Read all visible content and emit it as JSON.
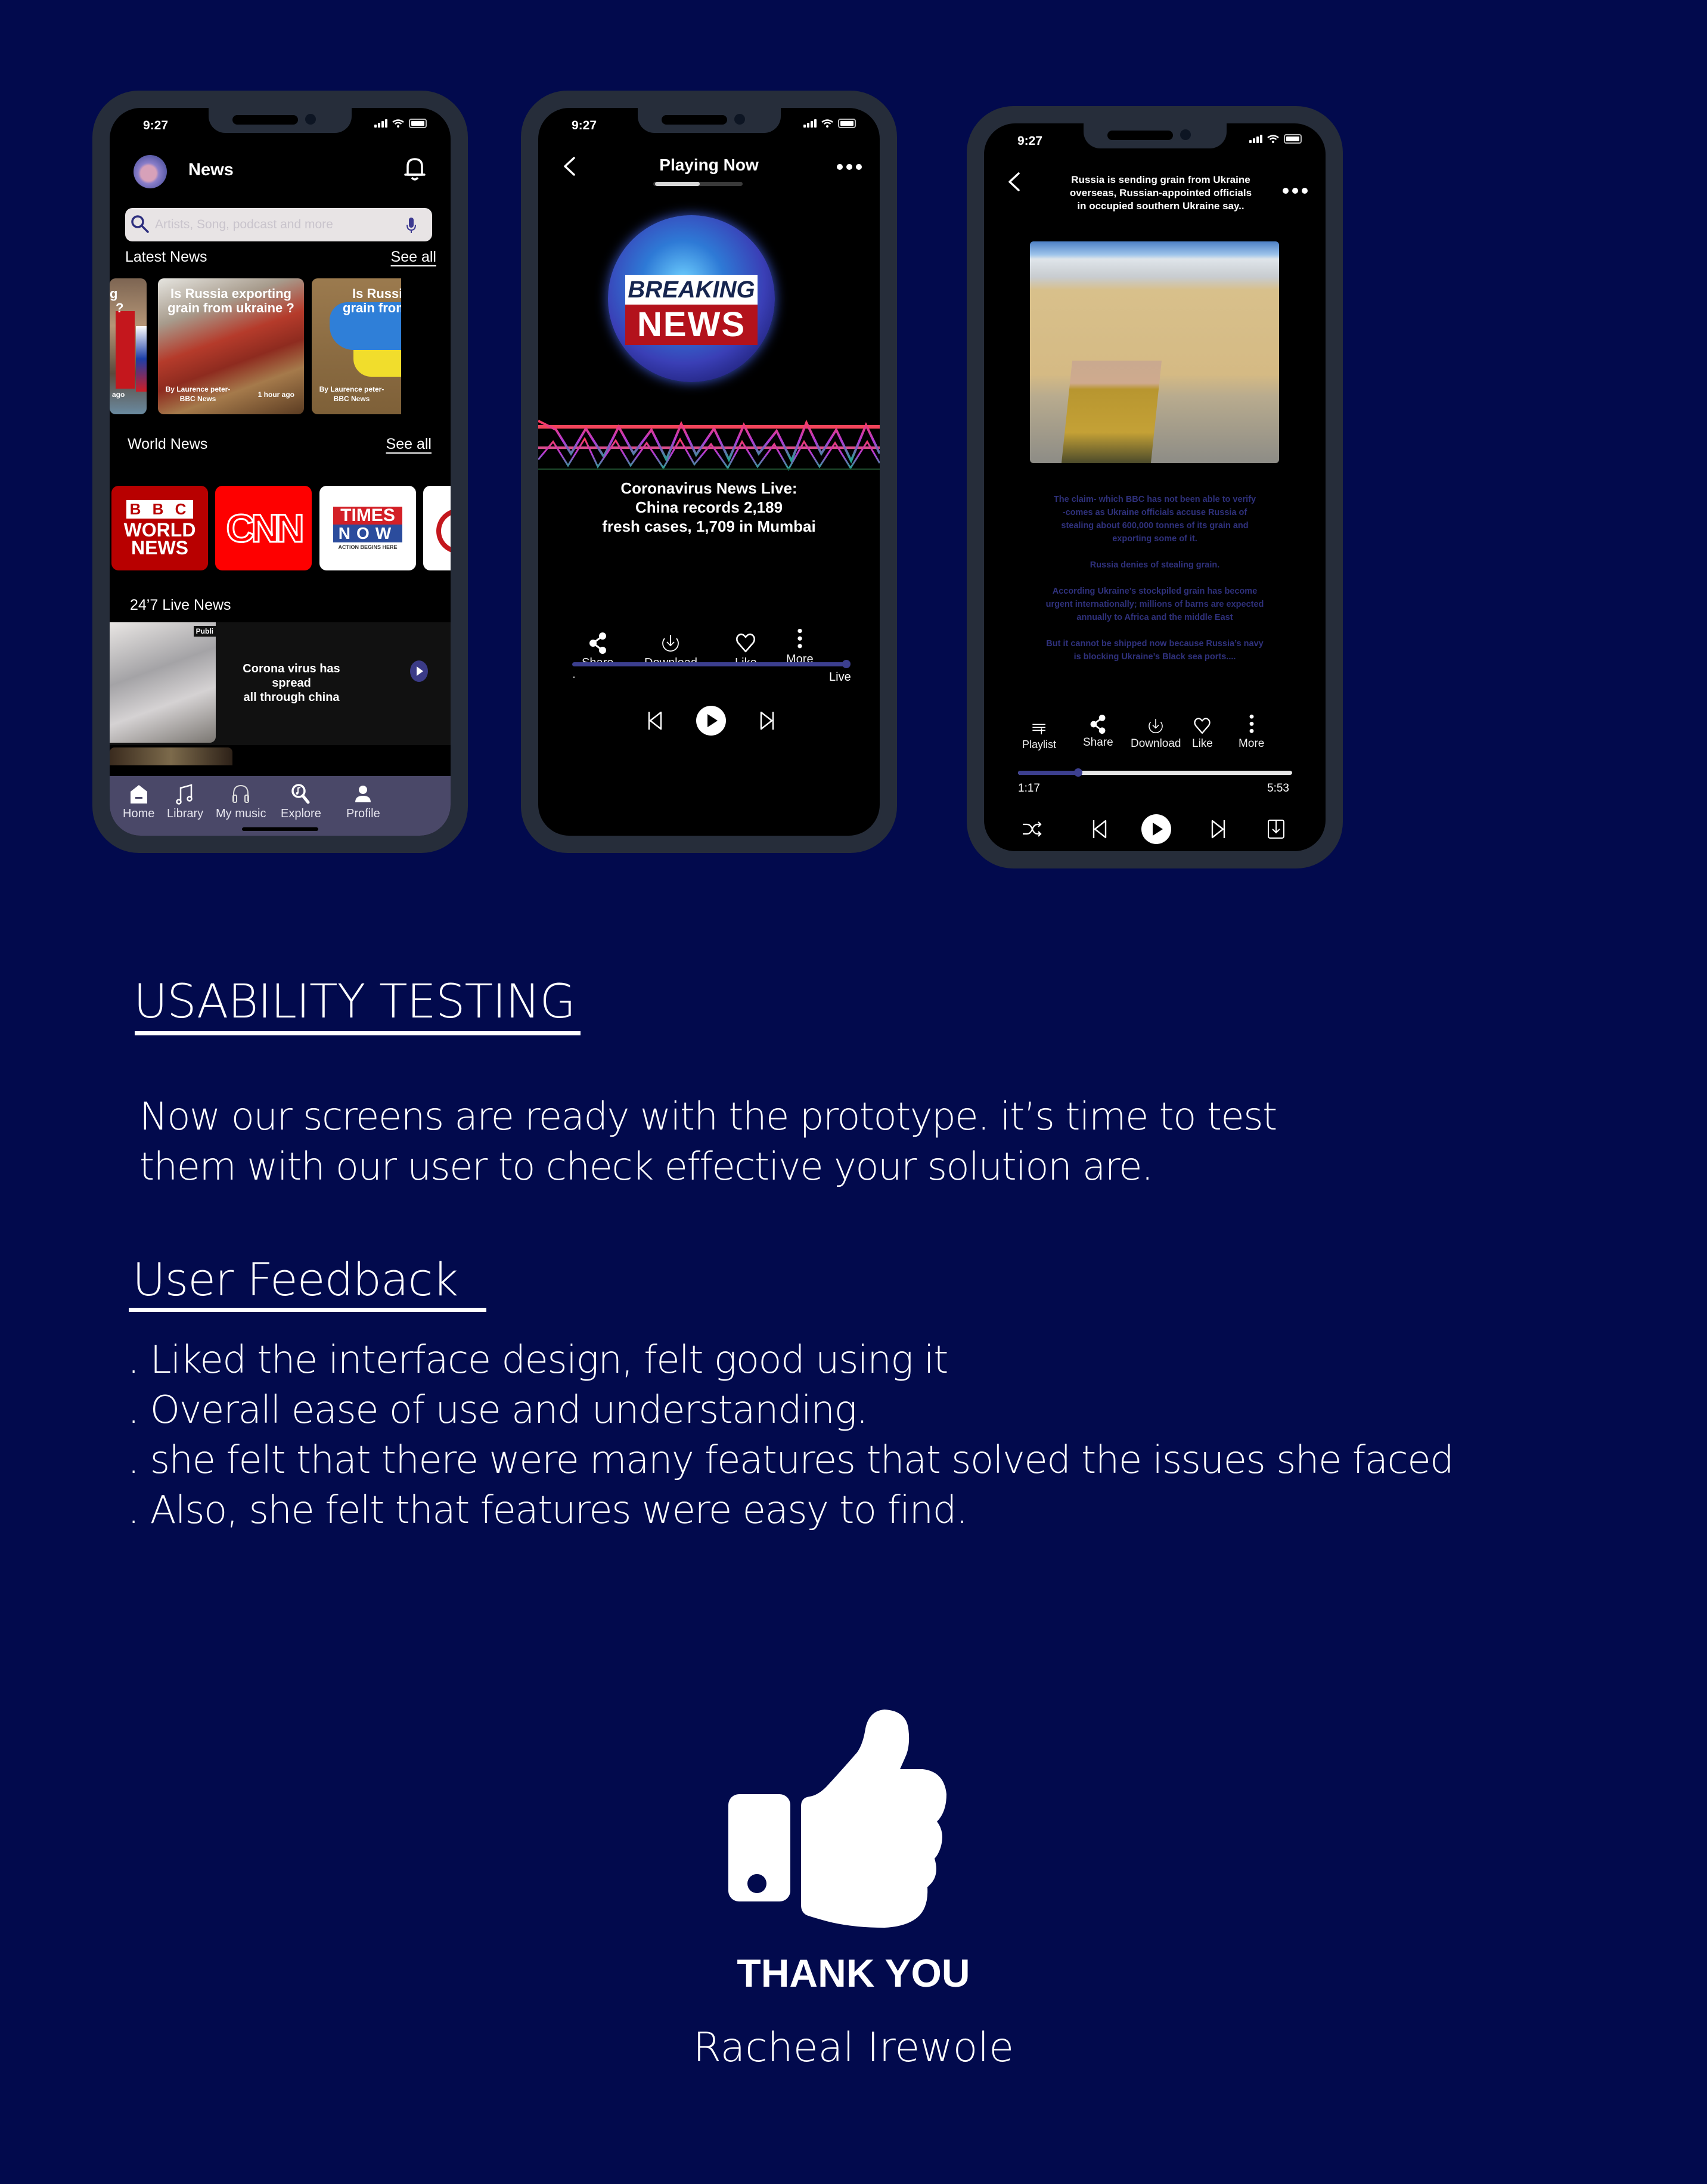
{
  "colors": {
    "background": "#020a4d",
    "phone_frame": "#262d3a",
    "accent": "#3c3f8f",
    "tab_bar": "#4a4868",
    "article_text": "#2f317c"
  },
  "status_bar": {
    "time": "9:27"
  },
  "phone_home": {
    "header_title": "News",
    "avatar_icon": "user-avatar",
    "bell_icon": "notification-bell-icon",
    "search": {
      "placeholder": "Artists, Song, podcast and more",
      "value": ""
    },
    "latest_news": {
      "label": "Latest News",
      "see_all": "See all",
      "cards": [
        {
          "headline_fragment": [
            "g",
            "?"
          ],
          "time": "ago"
        },
        {
          "headline": [
            "Is Russia exporting",
            "grain from ukraine ?"
          ],
          "byline": [
            "By Laurence peter-",
            "BBC News"
          ],
          "time": "1 hour ago"
        },
        {
          "headline": [
            "Is Russia e",
            "grain from"
          ],
          "byline": [
            "By Laurence peter-",
            "BBC News"
          ]
        }
      ]
    },
    "world_news": {
      "label": "World News",
      "see_all": "See all",
      "channels": [
        {
          "name": "BBC World News",
          "lines": [
            "B B C",
            "WORLD",
            "NEWS"
          ]
        },
        {
          "name": "CNN",
          "lines": [
            "CNN"
          ]
        },
        {
          "name": "Times Now",
          "lines": [
            "TIMES",
            "NOW",
            "ACTION BEGINS HERE"
          ]
        },
        {
          "name": "partial channel",
          "lines": []
        }
      ]
    },
    "live_news": {
      "label": "24’7 Live News",
      "items": [
        {
          "title": [
            "Corona virus has spread",
            "all through china"
          ],
          "thumb_badge": "Publi"
        }
      ]
    },
    "tab_bar": [
      {
        "label": "Home",
        "icon": "home-icon"
      },
      {
        "label": "Library",
        "icon": "music-note-icon"
      },
      {
        "label": "My music",
        "icon": "headphones-icon"
      },
      {
        "label": "Explore",
        "icon": "explore-search-icon"
      },
      {
        "label": "Profile",
        "icon": "profile-icon"
      }
    ]
  },
  "phone_player": {
    "title": "Playing Now",
    "header_progress_fraction": 0.5,
    "artwork": {
      "line1": "BREAKING",
      "line2": "NEWS"
    },
    "now_playing_text": [
      "Coronavirus News Live:",
      "China records 2,189",
      "fresh cases, 1,709 in Mumbai"
    ],
    "actions": [
      {
        "label": "Share",
        "icon": "share-icon"
      },
      {
        "label": "Download",
        "icon": "download-icon"
      },
      {
        "label": "Like",
        "icon": "heart-icon"
      },
      {
        "label": "More",
        "icon": "more-vertical-icon"
      }
    ],
    "progress": {
      "fraction": 1.0,
      "start_label": "·",
      "end_label": "Live"
    }
  },
  "phone_article": {
    "title": [
      "Russia is sending grain from Ukraine",
      "overseas, Russian-appointed officials",
      "in occupied southern Ukraine say.."
    ],
    "paragraphs": [
      [
        "The  claim- which BBC has not been able to verify",
        "-comes as Ukraine officials accuse Russia of",
        "stealing about 600,000 tonnes of its grain and",
        "exporting some of it."
      ],
      [
        "Russia denies of stealing grain."
      ],
      [
        "According Ukraine’s stockpiled grain has become",
        "urgent internationally; millions of barns are expected",
        "annually to Africa and the middle East"
      ],
      [
        "But it cannot be shipped now because Russia’s navy",
        "is blocking Ukraine’s Black sea ports...."
      ]
    ],
    "actions": [
      {
        "label": "Playlist",
        "icon": "playlist-add-icon"
      },
      {
        "label": "Share",
        "icon": "share-icon"
      },
      {
        "label": "Download",
        "icon": "download-icon"
      },
      {
        "label": "Like",
        "icon": "heart-icon"
      },
      {
        "label": "More",
        "icon": "more-vertical-icon"
      }
    ],
    "progress": {
      "fraction": 0.22,
      "current": "1:17",
      "total": "5:53"
    }
  },
  "usability": {
    "heading": "USABILITY TESTING",
    "paragraph": [
      "Now our screens are ready with the prototype. it’s time to test",
      "them with our user to check effective your solution are."
    ]
  },
  "feedback": {
    "heading": "User Feedback",
    "items": [
      ". Liked the interface design, felt good using it",
      ". Overall ease of use and understanding.",
      ". she felt that there were many features that solved the issues she faced",
      ". Also, she felt that features were easy to find."
    ]
  },
  "closing": {
    "icon": "thumbs-up-icon",
    "thanks": "THANK YOU",
    "author": "Racheal Irewole"
  }
}
